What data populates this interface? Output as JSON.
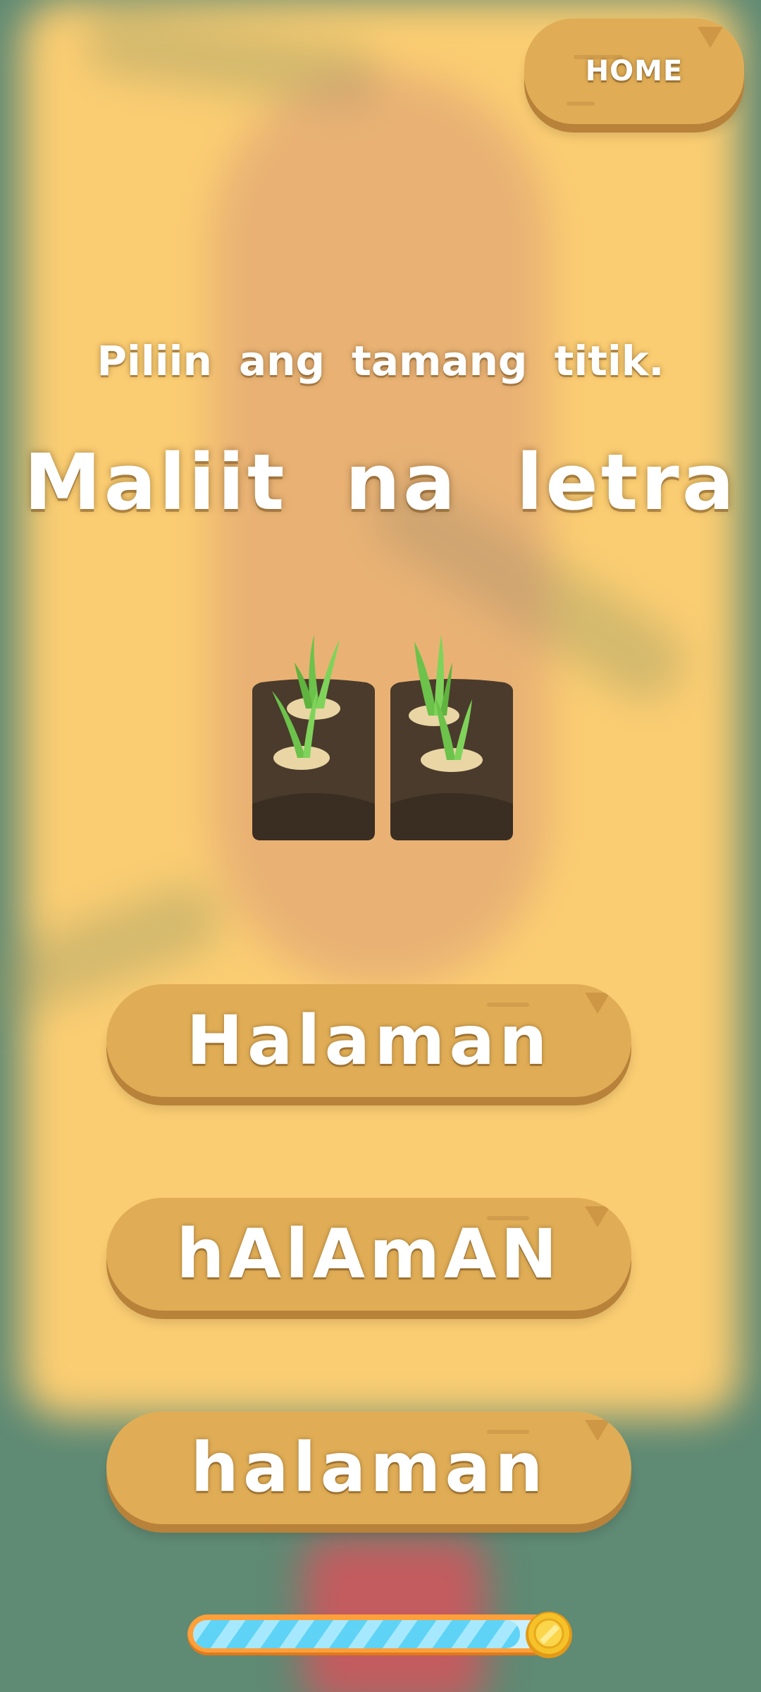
{
  "header": {
    "home_label": "HOME"
  },
  "question": {
    "instruction": "Piliin ang tamang titik.",
    "title": "Maliit na letra"
  },
  "image": {
    "icon": "green-onion-plants-icon"
  },
  "answers": [
    {
      "label": "Halaman"
    },
    {
      "label": "hAlAmAN"
    },
    {
      "label": "halaman"
    }
  ],
  "progress": {
    "value": 0.92,
    "icon": "coin-icon"
  },
  "colors": {
    "wood": "#e0ad56",
    "wood_shadow": "#b8823a",
    "panel": "#fbcd72",
    "background": "#5f8a74",
    "progress_fill": "#5fd3f6",
    "progress_border": "#ff9f3a",
    "coin": "#f2b820"
  }
}
